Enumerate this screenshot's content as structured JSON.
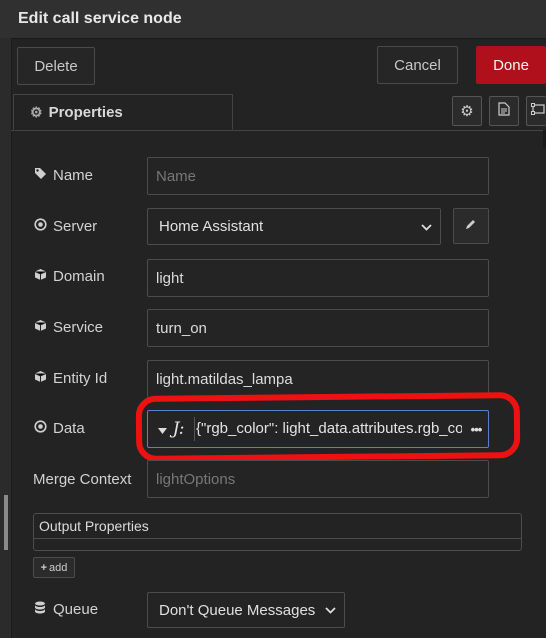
{
  "dialog": {
    "title": "Edit call service node"
  },
  "buttons": {
    "delete": "Delete",
    "cancel": "Cancel",
    "done": "Done",
    "add": "add"
  },
  "tabs": {
    "properties": "Properties"
  },
  "form": {
    "name": {
      "label": "Name",
      "value": "",
      "placeholder": "Name"
    },
    "server": {
      "label": "Server",
      "value": "Home Assistant"
    },
    "domain": {
      "label": "Domain",
      "value": "light"
    },
    "service": {
      "label": "Service",
      "value": "turn_on"
    },
    "entity_id": {
      "label": "Entity Id",
      "value": "light.matildas_lampa"
    },
    "data": {
      "label": "Data",
      "type_glyph": "J:",
      "value": "{\"rgb_color\": light_data.attributes.rgb_co"
    },
    "merge_context": {
      "label": "Merge Context",
      "value": "",
      "placeholder": "lightOptions"
    },
    "output_properties": {
      "label": "Output Properties"
    },
    "queue": {
      "label": "Queue",
      "value": "Don't Queue Messages"
    }
  },
  "icons": [
    "gear-icon",
    "description-icon",
    "appearance-icon",
    "tag-icon",
    "dot-circle-icon",
    "cube-icon",
    "pencil-icon",
    "caret-down-icon",
    "ellipsis-icon",
    "plus-icon",
    "database-icon"
  ],
  "colors": {
    "accent_done": "#b0101c",
    "annotation_red": "#ee1111",
    "focus_border": "#5a7fd0"
  }
}
